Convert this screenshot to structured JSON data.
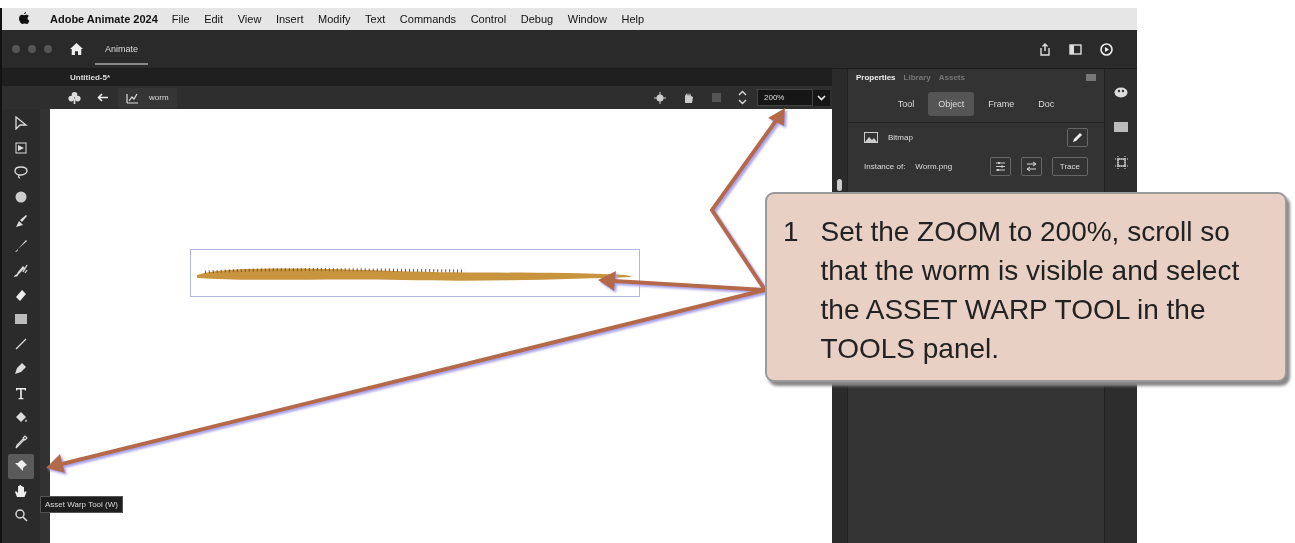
{
  "menu_bar": {
    "app_name": "Adobe Animate 2024",
    "items": [
      "File",
      "Edit",
      "View",
      "Insert",
      "Modify",
      "Text",
      "Commands",
      "Control",
      "Debug",
      "Window",
      "Help"
    ]
  },
  "title_bar": {
    "workspace_tab": "Animate"
  },
  "document_tab": {
    "title": "Untitled-5*"
  },
  "edit_bar": {
    "breadcrumb": "worm",
    "zoom": "200%"
  },
  "tools": [
    {
      "kind": "subselect",
      "selected": false
    },
    {
      "kind": "transform",
      "selected": false
    },
    {
      "kind": "lasso",
      "selected": false
    },
    {
      "kind": "fluid",
      "selected": false
    },
    {
      "kind": "paint",
      "selected": false
    },
    {
      "kind": "brush",
      "selected": false
    },
    {
      "kind": "classic",
      "selected": false
    },
    {
      "kind": "eraser",
      "selected": false
    },
    {
      "kind": "rect",
      "selected": false
    },
    {
      "kind": "line",
      "selected": false
    },
    {
      "kind": "pen",
      "selected": false
    },
    {
      "kind": "text",
      "selected": false
    },
    {
      "kind": "bucket",
      "selected": false
    },
    {
      "kind": "dropper",
      "selected": false
    },
    {
      "kind": "warp",
      "selected": true
    },
    {
      "kind": "hand",
      "selected": false
    },
    {
      "kind": "zoom",
      "selected": false
    }
  ],
  "tooltip": "Asset Warp Tool (W)",
  "properties": {
    "panel_tabs": [
      {
        "label": "Properties",
        "selected": true
      },
      {
        "label": "Library",
        "selected": false
      },
      {
        "label": "Assets",
        "selected": false
      }
    ],
    "sub_tabs": [
      {
        "label": "Tool",
        "selected": false
      },
      {
        "label": "Object",
        "selected": true
      },
      {
        "label": "Frame",
        "selected": false
      },
      {
        "label": "Doc",
        "selected": false
      }
    ],
    "object_type": "Bitmap",
    "instance_label": "Instance of:",
    "instance_value": "Worm.png",
    "trace_button": "Trace"
  },
  "callout": {
    "number": "1",
    "text": "Set the ZOOM to 200%, scroll so that the worm is visible and select the ASSET WARP TOOL in the TOOLS panel."
  }
}
